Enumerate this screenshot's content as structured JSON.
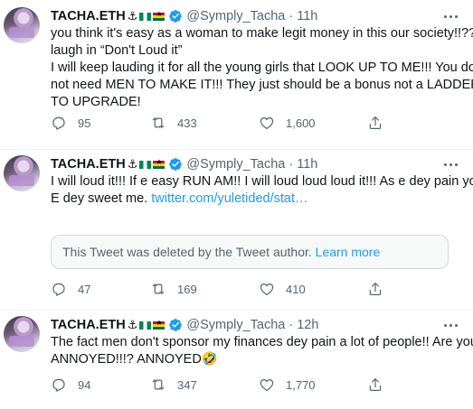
{
  "tweets": [
    {
      "name": "TACHA.ETH",
      "handle": "@Symply_Tacha",
      "time": "11h",
      "lines": [
        "you think it's easy as a woman to make legit money in this our society!!?? I",
        "laugh in “Don't Loud it”",
        "I will keep lauding it for all the young girls that LOOK UP TO ME!!! You do",
        "not need MEN TO MAKE IT!!! They just should be a bonus not a LADDER",
        "TO UPGRADE!"
      ],
      "replies": "95",
      "retweets": "433",
      "likes": "1,600"
    },
    {
      "name": "TACHA.ETH",
      "handle": "@Symply_Tacha",
      "time": "11h",
      "lines": [
        "I will loud it!!! If e easy RUN AM!! I will loud loud loud it!!! As e dey pain you",
        "E dey sweet me. "
      ],
      "link": "twitter.com/yuletided/stat…",
      "quote": {
        "text": "This Tweet was deleted by the Tweet author. ",
        "learn_more": "Learn more"
      },
      "replies": "47",
      "retweets": "169",
      "likes": "410"
    },
    {
      "name": "TACHA.ETH",
      "handle": "@Symply_Tacha",
      "time": "12h",
      "lines": [
        "The fact men don't sponsor my finances dey pain a lot of people!! Are you",
        "ANNOYED!!!? ANNOYED🤣"
      ],
      "replies": "94",
      "retweets": "347",
      "likes": "1,770"
    }
  ],
  "name_emoji": "⚓",
  "separator": "·",
  "colors": {
    "text": "#0f1419",
    "secondary": "#536471",
    "link": "#1d9bf0",
    "verified": "#1d9bf0",
    "divider": "#eff3f4"
  },
  "icons": [
    "verified-badge-icon",
    "more-icon",
    "reply-icon",
    "retweet-icon",
    "like-icon",
    "share-icon",
    "nigeria-flag-icon",
    "ghana-flag-icon",
    "anchor-icon"
  ]
}
